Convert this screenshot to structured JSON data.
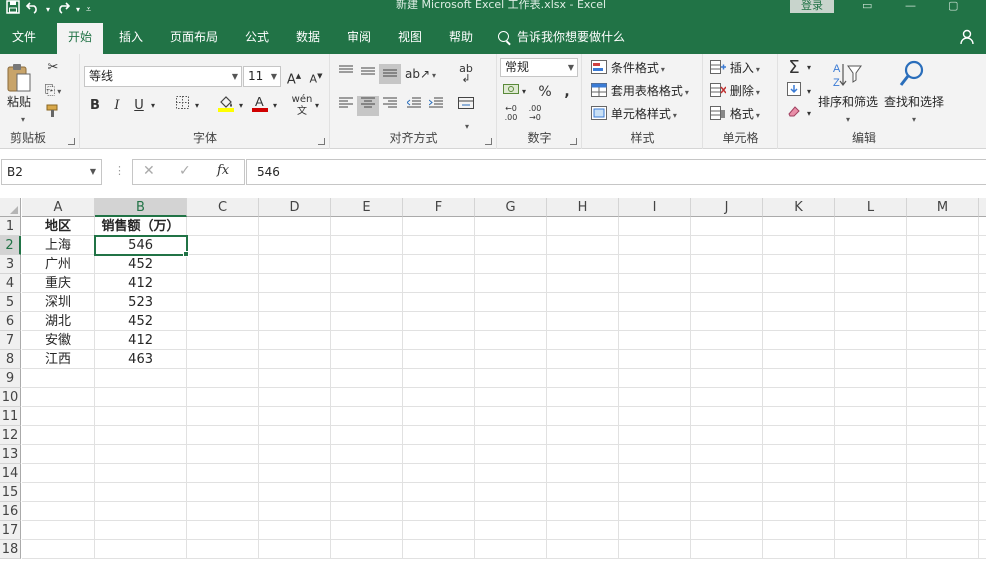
{
  "title_bar": {
    "window_title": "新建 Microsoft Excel 工作表.xlsx  -  Excel",
    "login_label": "登录",
    "quick_access": [
      "save-icon",
      "undo-icon",
      "redo-icon",
      "customize-icon"
    ]
  },
  "tabs": [
    {
      "label": "文件",
      "active": false
    },
    {
      "label": "开始",
      "active": true
    },
    {
      "label": "插入",
      "active": false
    },
    {
      "label": "页面布局",
      "active": false
    },
    {
      "label": "公式",
      "active": false
    },
    {
      "label": "数据",
      "active": false
    },
    {
      "label": "审阅",
      "active": false
    },
    {
      "label": "视图",
      "active": false
    },
    {
      "label": "帮助",
      "active": false
    }
  ],
  "tell_me": "告诉我你想要做什么",
  "ribbon": {
    "clipboard": {
      "group_label": "剪贴板",
      "paste_label": "粘贴"
    },
    "font": {
      "group_label": "字体",
      "font_name": "等线",
      "font_size": "11",
      "bold": "B",
      "italic": "I",
      "underline": "U",
      "font_color": "#d00000",
      "highlight_color": "#ffff00"
    },
    "alignment": {
      "group_label": "对齐方式"
    },
    "number": {
      "group_label": "数字",
      "format": "常规",
      "percent": "%"
    },
    "styles": {
      "group_label": "样式",
      "conditional": "条件格式",
      "table_format": "套用表格格式",
      "cell_styles": "单元格样式"
    },
    "cells": {
      "group_label": "单元格",
      "insert": "插入",
      "delete": "删除",
      "format": "格式"
    },
    "editing": {
      "group_label": "编辑",
      "sort_filter": "排序和筛选",
      "find_select": "查找和选择"
    }
  },
  "formula_bar": {
    "name_box": "B2",
    "cancel": "✕",
    "enter": "✓",
    "fx": "fx",
    "content": "546"
  },
  "sheet": {
    "columns": [
      "A",
      "B",
      "C",
      "D",
      "E",
      "F",
      "G",
      "H",
      "I",
      "J",
      "K",
      "L",
      "M"
    ],
    "rows": [
      "1",
      "2",
      "3",
      "4",
      "5",
      "6",
      "7",
      "8",
      "9",
      "10",
      "11",
      "12",
      "13",
      "14",
      "15",
      "16",
      "17",
      "18"
    ],
    "selected_cell": "B2",
    "header": {
      "region": "地区",
      "sales": "销售额（万）"
    },
    "data": [
      {
        "region": "上海",
        "sales": "546"
      },
      {
        "region": "广州",
        "sales": "452"
      },
      {
        "region": "重庆",
        "sales": "412"
      },
      {
        "region": "深圳",
        "sales": "523"
      },
      {
        "region": "湖北",
        "sales": "452"
      },
      {
        "region": "安徽",
        "sales": "412"
      },
      {
        "region": "江西",
        "sales": "463"
      }
    ]
  }
}
